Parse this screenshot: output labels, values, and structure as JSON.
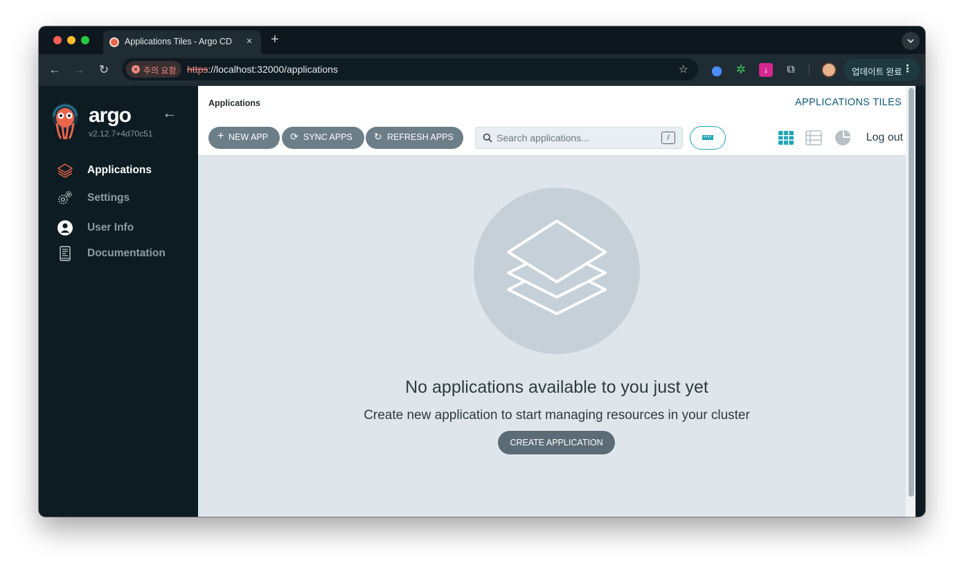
{
  "browser": {
    "tab_title": "Applications Tiles - Argo CD",
    "tab_close": "×",
    "new_tab": "+",
    "security_chip": "주의 요함",
    "url_scheme": "https",
    "url_rest": "://localhost:32000/applications",
    "update_button": "업데이트 완료",
    "menu_dots": "⋮"
  },
  "sidebar": {
    "brand": "argo",
    "version": "v2.12.7+4d70c51",
    "items": [
      {
        "label": "Applications",
        "icon": "layers-icon",
        "active": true
      },
      {
        "label": "Settings",
        "icon": "gears-icon",
        "active": false
      },
      {
        "label": "User Info",
        "icon": "user-icon",
        "active": false
      },
      {
        "label": "Documentation",
        "icon": "book-icon",
        "active": false
      }
    ]
  },
  "header": {
    "breadcrumb": "Applications",
    "title": "APPLICATIONS TILES"
  },
  "actions": {
    "new_app": "NEW APP",
    "sync_apps": "SYNC APPS",
    "refresh_apps": "REFRESH APPS",
    "search_placeholder": "Search applications...",
    "search_shortcut": "/",
    "logout": "Log out"
  },
  "empty_state": {
    "title": "No applications available to you just yet",
    "subtitle": "Create new application to start managing resources in your cluster",
    "button": "CREATE APPLICATION"
  },
  "colors": {
    "sidebar_bg": "#0d1b22",
    "content_bg": "#dee6eb",
    "accent": "#1fa5b7",
    "pill": "#6c7e88",
    "active_icon": "#e9664d"
  }
}
